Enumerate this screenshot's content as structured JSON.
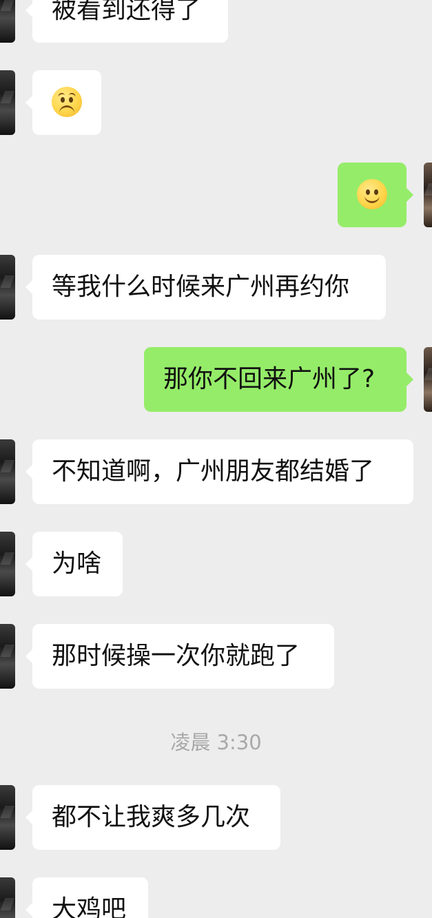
{
  "chat": {
    "messages": [
      {
        "side": "left",
        "text": "被看到还得了"
      },
      {
        "side": "left",
        "emoji": "pleading-face-emoji"
      },
      {
        "side": "right",
        "emoji": "smiling-face-emoji"
      },
      {
        "side": "left",
        "text": "等我什么时候来广州再约你"
      },
      {
        "side": "right",
        "text": "那你不回来广州了?"
      },
      {
        "side": "left",
        "text": "不知道啊，广州朋友都结婚了"
      },
      {
        "side": "left",
        "text": "为啥"
      },
      {
        "side": "left",
        "text": "那时候操一次你就跑了"
      },
      {
        "side": "left",
        "text": "都不让我爽多几次"
      },
      {
        "side": "left",
        "text": "大鸡吧"
      }
    ],
    "timestamp": "凌晨 3:30"
  },
  "colors": {
    "background": "#ededed",
    "incoming_bubble": "#ffffff",
    "outgoing_bubble": "#95ec69",
    "timestamp_text": "#a8a8a8"
  }
}
